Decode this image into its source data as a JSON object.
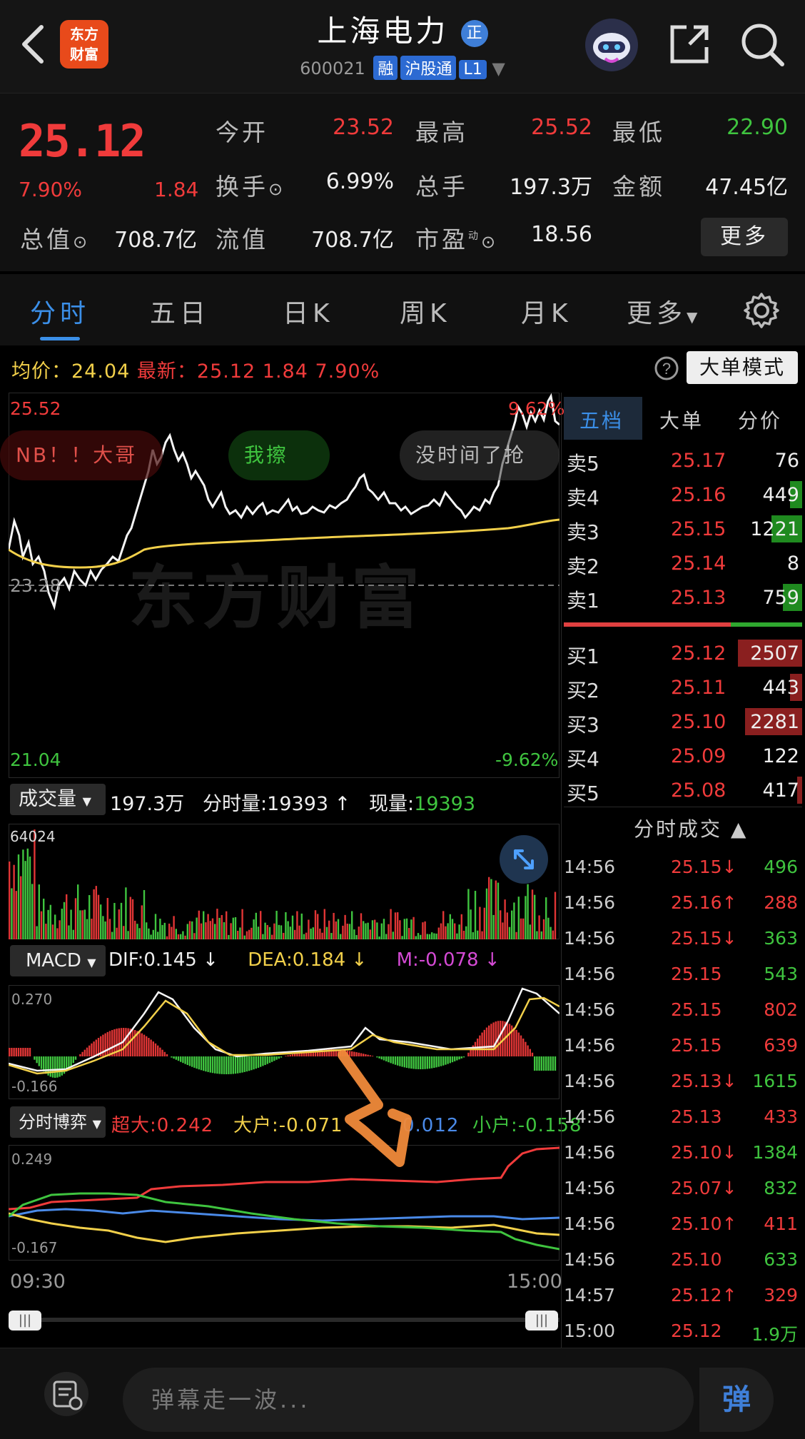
{
  "header": {
    "logo_text_1": "东方",
    "logo_text_2": "财富",
    "title": "上海电力",
    "title_badge": "正",
    "code": "600021",
    "tags": [
      "融",
      "沪股通",
      "L1"
    ]
  },
  "quote": {
    "price": "25.12",
    "pct": "7.90%",
    "change": "1.84",
    "open_label": "今开",
    "open": "23.52",
    "high_label": "最高",
    "high": "25.52",
    "low_label": "最低",
    "low": "22.90",
    "turnover_label": "换手",
    "turnover": "6.99%",
    "volume_label": "总手",
    "volume": "197.3万",
    "amount_label": "金额",
    "amount": "47.45亿",
    "mktcap_label": "总值",
    "mktcap": "708.7亿",
    "float_label": "流值",
    "float_cap": "708.7亿",
    "pe_label": "市盈",
    "pe_sup": "动",
    "pe": "18.56",
    "more_label": "更多"
  },
  "tabs": [
    "分时",
    "五日",
    "日K",
    "周K",
    "月K",
    "更多"
  ],
  "chart_info": {
    "avg_label": "均价",
    "avg": "24.04",
    "latest_label": "最新",
    "latest": "25.12",
    "latest_change": "1.84",
    "latest_pct": "7.90%",
    "mode_button": "大单模式"
  },
  "price_chart": {
    "y_high": "25.52",
    "y_high_pct": "9.62%",
    "y_mid": "23.28",
    "y_low": "21.04",
    "y_low_pct": "-9.62%",
    "watermark": "东方财富",
    "danmaku": [
      "NB！！大哥",
      "我擦",
      "没时间了抢"
    ]
  },
  "volume_panel": {
    "selector": "成交量",
    "total": "197.3万",
    "minute_label": "分时量",
    "minute_value": "19393",
    "current_label": "现量",
    "current_value": "19393",
    "y_max": "64024"
  },
  "macd_panel": {
    "selector": "MACD",
    "dif": "DIF:0.145 ↓",
    "dea": "DEA:0.184 ↓",
    "m": "M:-0.078 ↓",
    "y_max": "0.270",
    "y_min": "-0.166"
  },
  "game_panel": {
    "selector": "分时博弈",
    "super_large": "超大:0.242",
    "large": "大户:-0.071",
    "medium": "0.012",
    "small": "小户:-0.158",
    "y_max": "0.249",
    "y_min": "-0.167"
  },
  "time_axis": {
    "start": "09:30",
    "end": "15:00"
  },
  "order_book": {
    "tabs": [
      "五档",
      "大单",
      "分价"
    ],
    "asks": [
      {
        "label": "卖5",
        "price": "25.17",
        "vol": "76",
        "bar": 0
      },
      {
        "label": "卖4",
        "price": "25.16",
        "vol": "449",
        "bar": 0.05
      },
      {
        "label": "卖3",
        "price": "25.15",
        "vol": "1221",
        "bar": 0.13
      },
      {
        "label": "卖2",
        "price": "25.14",
        "vol": "8",
        "bar": 0
      },
      {
        "label": "卖1",
        "price": "25.13",
        "vol": "759",
        "bar": 0.08
      }
    ],
    "bids": [
      {
        "label": "买1",
        "price": "25.12",
        "vol": "2507",
        "bar": 0.27
      },
      {
        "label": "买2",
        "price": "25.11",
        "vol": "443",
        "bar": 0.05
      },
      {
        "label": "买3",
        "price": "25.10",
        "vol": "2281",
        "bar": 0.24
      },
      {
        "label": "买4",
        "price": "25.09",
        "vol": "122",
        "bar": 0
      },
      {
        "label": "买5",
        "price": "25.08",
        "vol": "417",
        "bar": 0.02
      }
    ]
  },
  "ticks": {
    "title": "分时成交",
    "rows": [
      {
        "time": "14:56",
        "price": "25.15↓",
        "vol": "496",
        "pc": "red",
        "vc": "green"
      },
      {
        "time": "14:56",
        "price": "25.16↑",
        "vol": "288",
        "pc": "red",
        "vc": "red"
      },
      {
        "time": "14:56",
        "price": "25.15↓",
        "vol": "363",
        "pc": "red",
        "vc": "green"
      },
      {
        "time": "14:56",
        "price": "25.15",
        "vol": "543",
        "pc": "red",
        "vc": "green"
      },
      {
        "time": "14:56",
        "price": "25.15",
        "vol": "802",
        "pc": "red",
        "vc": "red"
      },
      {
        "time": "14:56",
        "price": "25.15",
        "vol": "639",
        "pc": "red",
        "vc": "red"
      },
      {
        "time": "14:56",
        "price": "25.13↓",
        "vol": "1615",
        "pc": "red",
        "vc": "green"
      },
      {
        "time": "14:56",
        "price": "25.13",
        "vol": "433",
        "pc": "red",
        "vc": "red"
      },
      {
        "time": "14:56",
        "price": "25.10↓",
        "vol": "1384",
        "pc": "red",
        "vc": "green"
      },
      {
        "time": "14:56",
        "price": "25.07↓",
        "vol": "832",
        "pc": "red",
        "vc": "green"
      },
      {
        "time": "14:56",
        "price": "25.10↑",
        "vol": "411",
        "pc": "red",
        "vc": "red"
      },
      {
        "time": "14:56",
        "price": "25.10",
        "vol": "633",
        "pc": "red",
        "vc": "green"
      },
      {
        "time": "14:57",
        "price": "25.12↑",
        "vol": "329",
        "pc": "red",
        "vc": "red"
      },
      {
        "time": "15:00",
        "price": "25.12",
        "vol": "1.9万",
        "pc": "red",
        "vc": "green"
      }
    ]
  },
  "danmaku_input": {
    "placeholder": "弹幕走一波...",
    "send": "弹"
  },
  "colors": {
    "up": "#f03b3b",
    "down": "#3fc43f",
    "accent": "#3b8fe8",
    "avg_line": "#f2d04a"
  }
}
